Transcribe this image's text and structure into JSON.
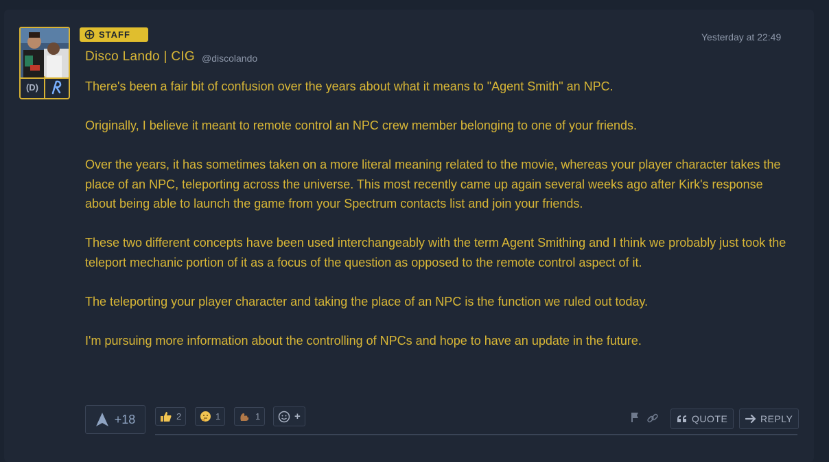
{
  "post": {
    "badge_label": "STAFF",
    "username": "Disco Lando | CIG",
    "handle": "@discolando",
    "timestamp": "Yesterday at 22:49",
    "sub_badges": [
      "(D)"
    ],
    "paragraphs": [
      "There's been a fair bit of confusion over the years about what it means to \"Agent Smith\" an NPC.",
      "Originally, I believe it meant to remote control an NPC crew member belonging to one of your friends.",
      "Over the years, it has sometimes taken on a more literal meaning related to the movie, whereas your player character takes the place of an NPC, teleporting across the universe. This most recently came up again several weeks ago after Kirk's response about being able to launch the game from your Spectrum contacts list and join your friends.",
      "These two different concepts have been used interchangeably with the term Agent Smithing and I think we probably just took the teleport mechanic portion of it as a focus of the question as opposed to the remote control aspect of it.",
      "The teleporting your player character and taking the place of an NPC is the function we ruled out today.",
      "I'm pursuing more information about the controlling of NPCs and hope to have an update in the future."
    ]
  },
  "footer": {
    "upvotes": "+18",
    "reactions": [
      {
        "icon": "thumbs-up-icon",
        "count": "2"
      },
      {
        "icon": "thinking-face-icon",
        "count": "1"
      },
      {
        "icon": "squirrel-icon",
        "count": "1"
      }
    ],
    "add_reaction_plus": "+",
    "quote_label": "QUOTE",
    "reply_label": "REPLY"
  },
  "colors": {
    "accent": "#d9b736",
    "background": "#1b2330",
    "card": "#1f2735",
    "muted": "#8e98aa"
  }
}
